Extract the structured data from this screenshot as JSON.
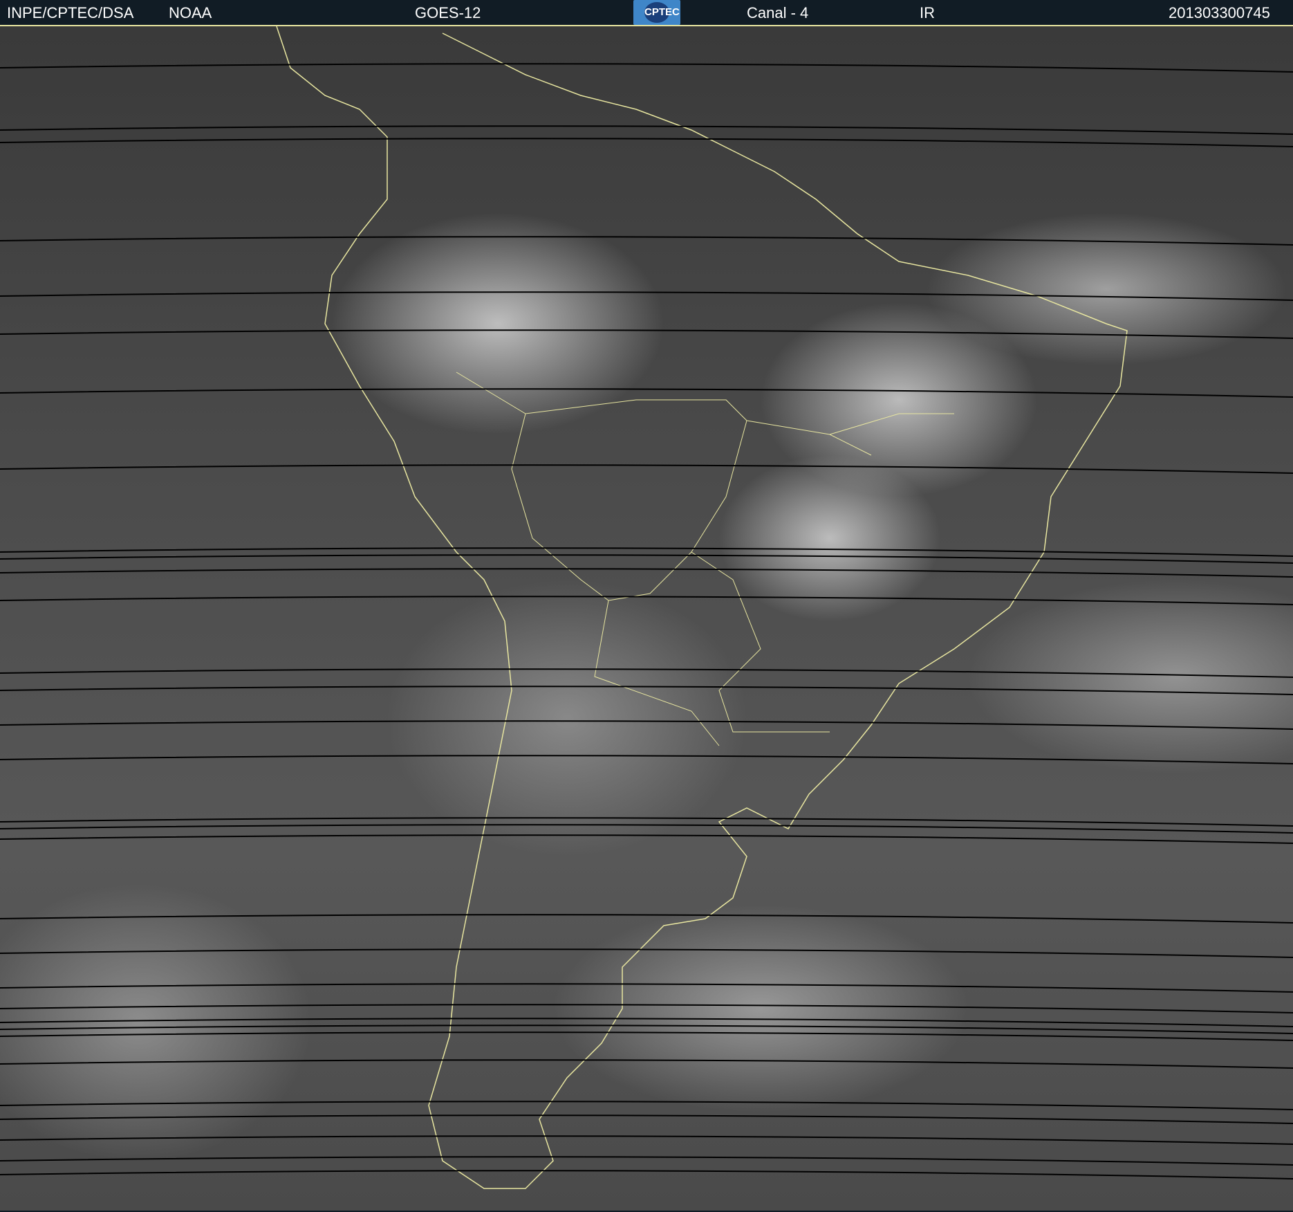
{
  "header": {
    "agency": "INPE/CPTEC/DSA",
    "source": "NOAA",
    "satellite": "GOES-12",
    "logo_text": "CPTEC",
    "channel": "Canal - 4",
    "band": "IR",
    "timestamp": "201303300745"
  },
  "colors": {
    "header_bg": "#111c25",
    "coastline": "#e8e6a0"
  }
}
